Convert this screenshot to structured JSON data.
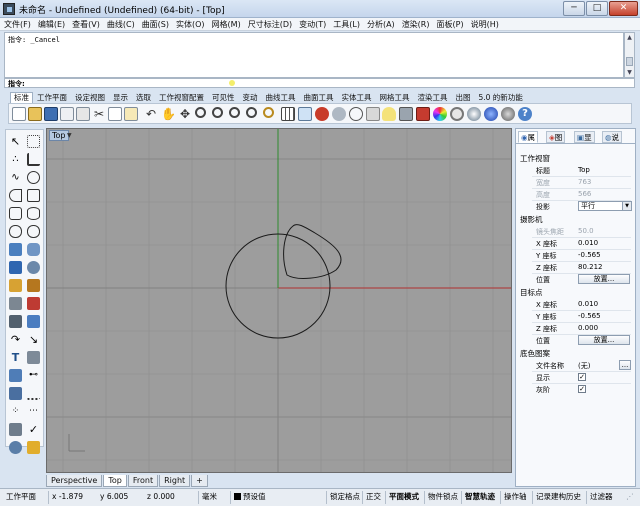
{
  "window": {
    "title": "未命名 - Undefined (Undefined) (64-bit) - [Top]",
    "min_label": "─",
    "max_label": "□",
    "close_label": "✕"
  },
  "menu": [
    "文件(F)",
    "编辑(E)",
    "查看(V)",
    "曲线(C)",
    "曲面(S)",
    "实体(O)",
    "网格(M)",
    "尺寸标注(D)",
    "变动(T)",
    "工具(L)",
    "分析(A)",
    "渲染(R)",
    "面板(P)",
    "说明(H)"
  ],
  "command": {
    "history": "指令: _Cancel",
    "prompt_label": "指令:",
    "input_value": ""
  },
  "toolbar_tabs": [
    "标准",
    "工作平面",
    "设定视图",
    "显示",
    "选取",
    "工作视窗配置",
    "可见性",
    "变动",
    "曲线工具",
    "曲面工具",
    "实体工具",
    "网格工具",
    "渲染工具",
    "出图",
    "5.0 的新功能"
  ],
  "viewport": {
    "label": "Top",
    "tabs": [
      "Perspective",
      "Top",
      "Front",
      "Right"
    ],
    "add_tab": "+"
  },
  "panel": {
    "tabs": [
      "属",
      "图",
      "显",
      "说"
    ],
    "sections": {
      "viewport": "工作视窗",
      "camera": "摄影机",
      "target": "目标点",
      "wallpaper": "底色图案"
    },
    "title_label": "标题",
    "title_value": "Top",
    "width_label": "宽度",
    "width_value": "763",
    "height_label": "高度",
    "height_value": "566",
    "projection_label": "投影",
    "projection_value": "平行",
    "lens_label": "镜头焦距",
    "lens_value": "50.0",
    "cam_x_label": "X 座标",
    "cam_x_value": "0.010",
    "cam_y_label": "Y 座标",
    "cam_y_value": "-0.565",
    "cam_z_label": "Z 座标",
    "cam_z_value": "80.212",
    "cam_pos_label": "位置",
    "place_button": "放置...",
    "tgt_x_label": "X 座标",
    "tgt_x_value": "0.010",
    "tgt_y_label": "Y 座标",
    "tgt_y_value": "-0.565",
    "tgt_z_label": "Z 座标",
    "tgt_z_value": "0.000",
    "tgt_pos_label": "位置",
    "tgt_place_button": "放置...",
    "file_label": "文件名称",
    "file_value": "(无)",
    "file_browse": "...",
    "show_label": "显示",
    "show_checked": "✓",
    "gray_label": "灰阶",
    "gray_checked": "✓"
  },
  "status": {
    "cplane": "工作平面",
    "x": "x -1.879",
    "y": "y 6.005",
    "z": "z 0.000",
    "units": "毫米",
    "layer": "预设值",
    "layer_color": "#000000",
    "toggles": [
      "锁定格点",
      "正交",
      "平面模式",
      "物件锁点",
      "智慧轨迹",
      "操作轴",
      "记录建构历史",
      "过滤器"
    ],
    "bold_toggles": [
      "平面模式",
      "智慧轨迹"
    ],
    "resize_grip": "⋰"
  },
  "colors": {
    "viewport_bg": "#9d9d9d",
    "axis_x": "#b03030",
    "axis_y": "#2f8a2f",
    "curve": "#1a1a1a"
  }
}
